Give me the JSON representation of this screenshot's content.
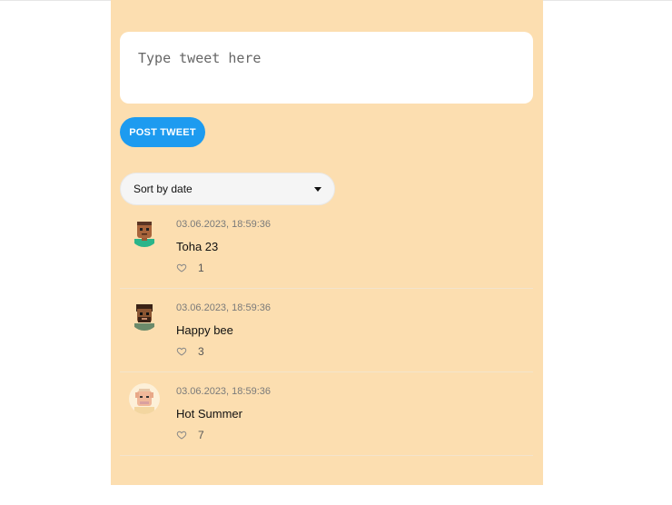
{
  "compose": {
    "placeholder": "Type tweet here",
    "button_label": "POST TWEET"
  },
  "sort": {
    "selected": "Sort by date"
  },
  "tweets": [
    {
      "date": "03.06.2023, 18:59:36",
      "text": "Toha 23",
      "likes": "1"
    },
    {
      "date": "03.06.2023, 18:59:36",
      "text": "Happy bee",
      "likes": "3"
    },
    {
      "date": "03.06.2023, 18:59:36",
      "text": "Hot Summer",
      "likes": "7"
    }
  ],
  "colors": {
    "panel": "#fcdeb0",
    "accent": "#1d9bf0"
  },
  "icons": {
    "like": "heart-icon",
    "sort": "caret-down-icon"
  }
}
